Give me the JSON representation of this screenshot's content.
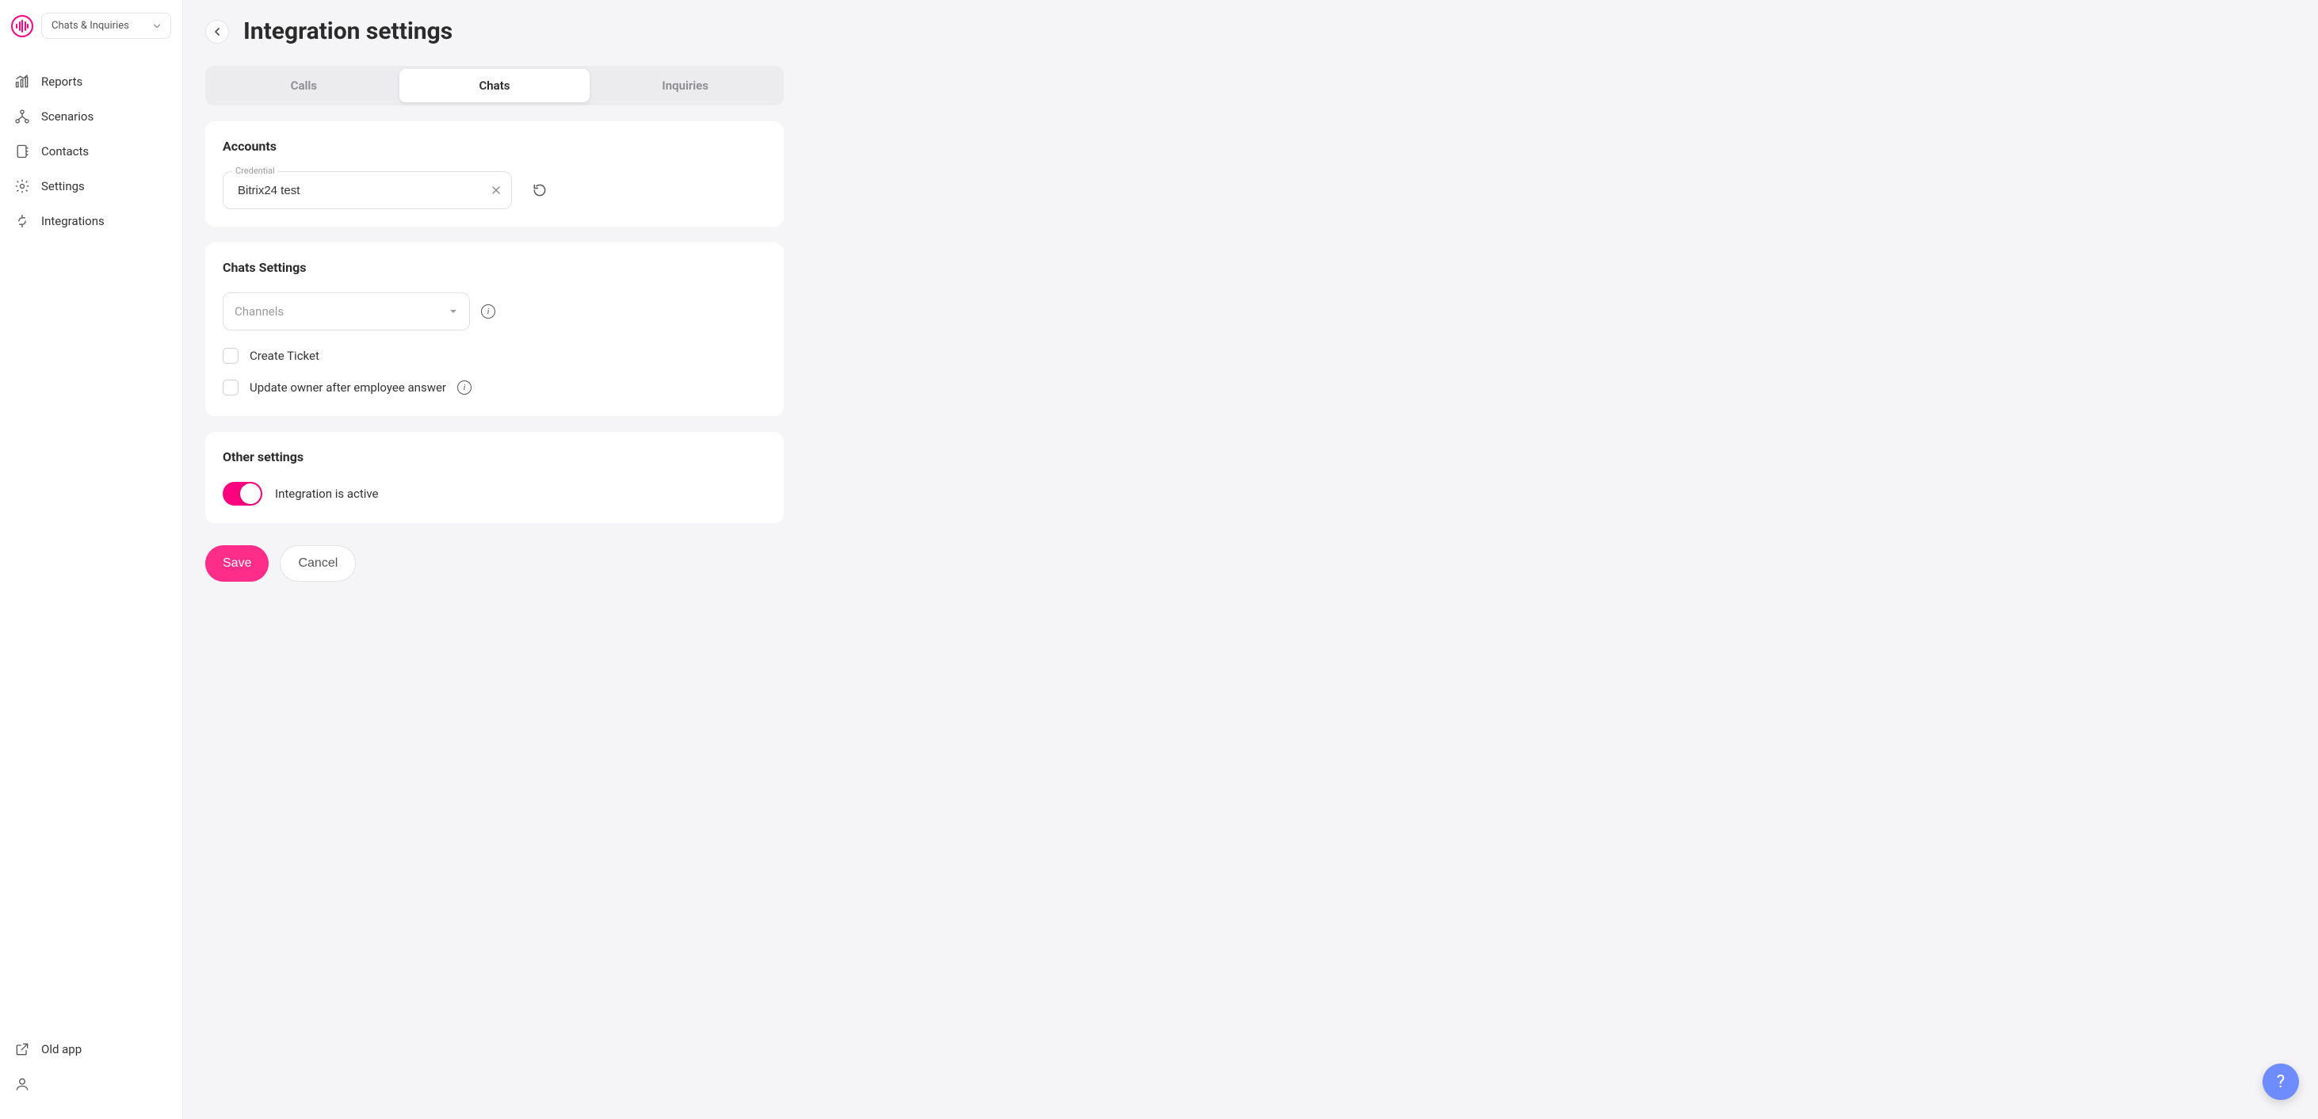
{
  "module_selector": {
    "label": "Chats & Inquiries"
  },
  "sidebar": {
    "items": [
      {
        "label": "Reports"
      },
      {
        "label": "Scenarios"
      },
      {
        "label": "Contacts"
      },
      {
        "label": "Settings"
      },
      {
        "label": "Integrations"
      }
    ],
    "footer": [
      {
        "label": "Old app"
      },
      {
        "label": ""
      }
    ]
  },
  "page": {
    "title": "Integration settings"
  },
  "tabs": [
    {
      "label": "Calls",
      "active": false
    },
    {
      "label": "Chats",
      "active": true
    },
    {
      "label": "Inquiries",
      "active": false
    }
  ],
  "accounts": {
    "heading": "Accounts",
    "credential_label": "Credential",
    "credential_value": "Bitrix24 test"
  },
  "chats_settings": {
    "heading": "Chats Settings",
    "channels_placeholder": "Channels",
    "create_ticket_label": "Create Ticket",
    "update_owner_label": "Update owner after employee answer"
  },
  "other_settings": {
    "heading": "Other settings",
    "active_label": "Integration is active",
    "is_active": true
  },
  "buttons": {
    "save": "Save",
    "cancel": "Cancel"
  },
  "help_fab": "?"
}
